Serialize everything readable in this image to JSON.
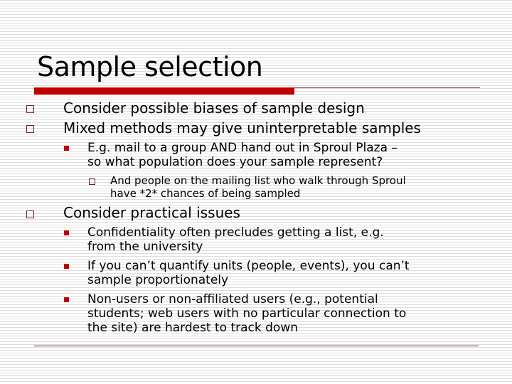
{
  "slide": {
    "title": "Sample selection",
    "colors": {
      "accent_bar": "#c00000",
      "rule_line": "#7a1f2b",
      "bullet_outline": "#6e1f2e",
      "bullet_fill": "#c00000"
    },
    "bullets": [
      {
        "icon": "open-square-bullet",
        "text": "Consider possible biases of sample design"
      },
      {
        "icon": "open-square-bullet",
        "text": "Mixed methods  may give uninterpretable samples",
        "children": [
          {
            "icon": "filled-square-bullet",
            "lines": [
              "E.g. mail to a group AND hand out in Sproul Plaza –",
              "so what population does your sample represent?"
            ],
            "children": [
              {
                "icon": "open-square-bullet",
                "lines": [
                  "And people on the mailing list who walk through Sproul",
                  "have *2* chances of being sampled"
                ]
              }
            ]
          }
        ]
      },
      {
        "icon": "open-square-bullet",
        "text": "Consider practical issues",
        "children": [
          {
            "icon": "filled-square-bullet",
            "lines": [
              "Confidentiality often precludes getting a list, e.g.",
              "from the university"
            ]
          },
          {
            "icon": "filled-square-bullet",
            "lines": [
              "If you can’t quantify units (people, events),  you can’t",
              "sample proportionately"
            ]
          },
          {
            "icon": "filled-square-bullet",
            "lines": [
              "Non-users or non-affiliated users (e.g., potential",
              "students; web users with no particular connection to",
              "the site) are hardest to track down"
            ]
          }
        ]
      }
    ]
  }
}
